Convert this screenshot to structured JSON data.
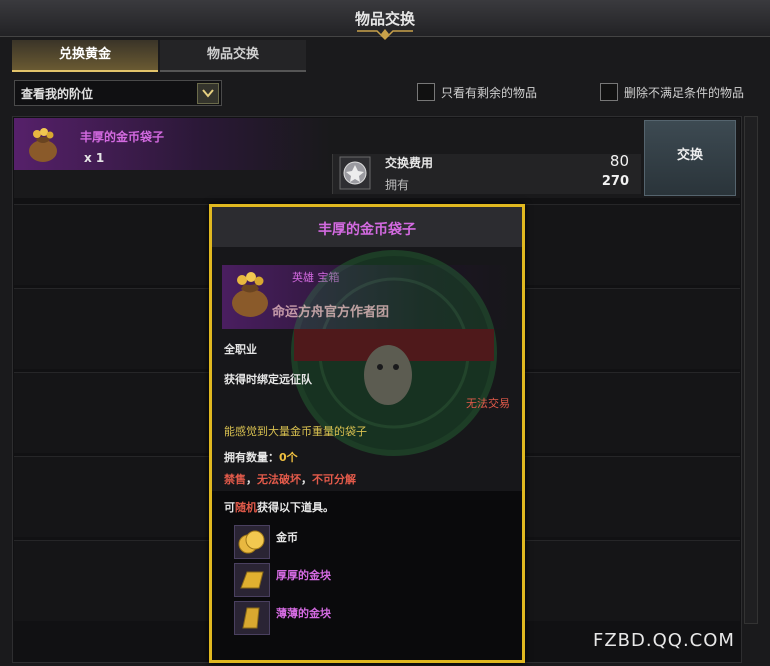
{
  "window": {
    "title": "物品交换"
  },
  "tabs": [
    {
      "label": "兑换黄金",
      "active": true
    },
    {
      "label": "物品交换",
      "active": false
    }
  ],
  "filters": {
    "dropdown_value": "查看我的阶位",
    "checkbox1": "只看有剩余的物品",
    "checkbox2": "删除不满足条件的物品"
  },
  "exchange_item": {
    "name": "丰厚的金币袋子",
    "quantity": "x 1",
    "cost_label": "交换费用",
    "cost_value": "80",
    "own_label": "拥有",
    "own_value": "270",
    "button_label": "交换"
  },
  "tooltip": {
    "title": "丰厚的金币袋子",
    "grade": "英雄 宝箱",
    "line_class": "全职业",
    "line_bind": "获得时绑定远征队",
    "line_trade": "无法交易",
    "description": "能感觉到大量金币重量的袋子",
    "own_count_label": "拥有数量：",
    "own_count_value": "0个",
    "restrict1": "禁售",
    "restrict_sep1": "，",
    "restrict2": "无法破坏",
    "restrict_sep2": "，",
    "restrict3": "不可分解",
    "random_prefix": "可",
    "random_word": "随机",
    "random_suffix": "获得以下道具。",
    "rewards": [
      "金币",
      "厚厚的金块",
      "薄薄的金块"
    ]
  },
  "watermark": {
    "text": "命运方舟官方作者团"
  },
  "footer": {
    "text": "FZBD.QQ.COM"
  },
  "colors": {
    "accent_gold": "#e0b820",
    "heroic_purple": "#d36ae0",
    "warning_red": "#e25a4a"
  }
}
